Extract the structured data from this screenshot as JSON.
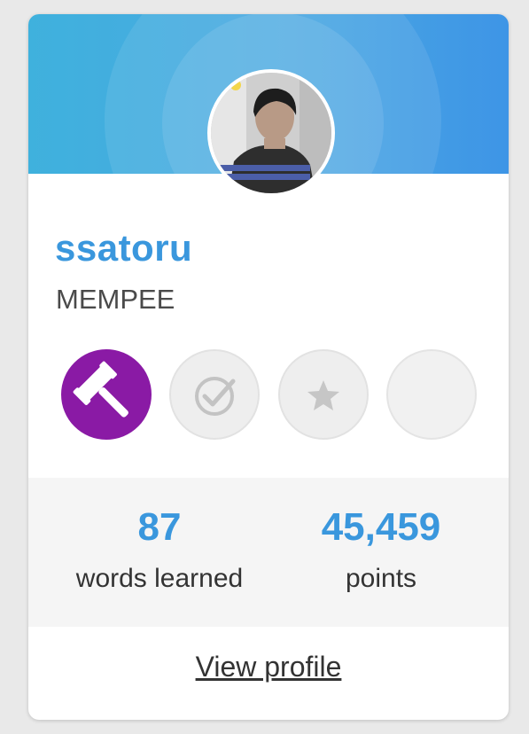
{
  "profile": {
    "username": "ssatoru",
    "subtitle": "MEMPEE"
  },
  "badges": [
    {
      "icon": "gavel-icon",
      "earned": true,
      "color": "#8a1aa5"
    },
    {
      "icon": "checkmark-icon",
      "earned": false
    },
    {
      "icon": "star-icon",
      "earned": false
    },
    {
      "icon": "empty-badge",
      "earned": false
    }
  ],
  "stats": {
    "words_value": "87",
    "words_label": "words learned",
    "points_value": "45,459",
    "points_label": "points"
  },
  "links": {
    "view_profile": "View profile"
  },
  "colors": {
    "accent": "#3a97dd",
    "banner_start": "#3fb1dd",
    "banner_end": "#3e95e6",
    "earned_badge": "#8a1aa5"
  }
}
